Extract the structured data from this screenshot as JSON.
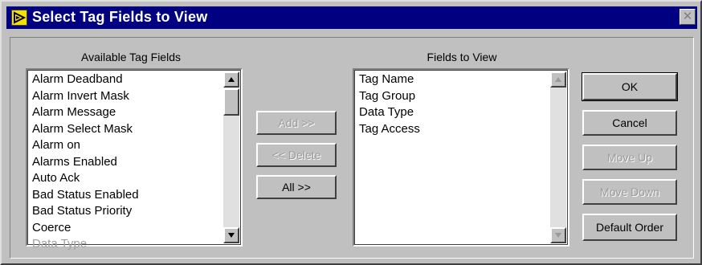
{
  "window": {
    "title": "Select Tag Fields to View",
    "close_symbol": "✕",
    "icon": "app-arrow-icon"
  },
  "available": {
    "label": "Available Tag Fields",
    "items": [
      {
        "label": "Alarm Deadband",
        "disabled": false
      },
      {
        "label": "Alarm Invert Mask",
        "disabled": false
      },
      {
        "label": "Alarm Message",
        "disabled": false
      },
      {
        "label": "Alarm Select Mask",
        "disabled": false
      },
      {
        "label": "Alarm on",
        "disabled": false
      },
      {
        "label": "Alarms Enabled",
        "disabled": false
      },
      {
        "label": "Auto Ack",
        "disabled": false
      },
      {
        "label": "Bad Status Enabled",
        "disabled": false
      },
      {
        "label": "Bad Status Priority",
        "disabled": false
      },
      {
        "label": "Coerce",
        "disabled": false
      },
      {
        "label": "Data Type",
        "disabled": true
      }
    ]
  },
  "selected": {
    "label": "Fields to View",
    "items": [
      {
        "label": "Tag Name",
        "disabled": false
      },
      {
        "label": "Tag Group",
        "disabled": false
      },
      {
        "label": "Data Type",
        "disabled": false
      },
      {
        "label": "Tag Access",
        "disabled": false
      }
    ]
  },
  "middle_buttons": {
    "add": "Add >>",
    "delete": "<< Delete",
    "all": "All >>"
  },
  "right_buttons": {
    "ok": "OK",
    "cancel": "Cancel",
    "move_up": "Move Up",
    "move_down": "Move Down",
    "default_order": "Default Order"
  },
  "colors": {
    "titlebar": "#000080",
    "face": "#c0c0c0",
    "disabled_text": "#a0a0a0"
  }
}
